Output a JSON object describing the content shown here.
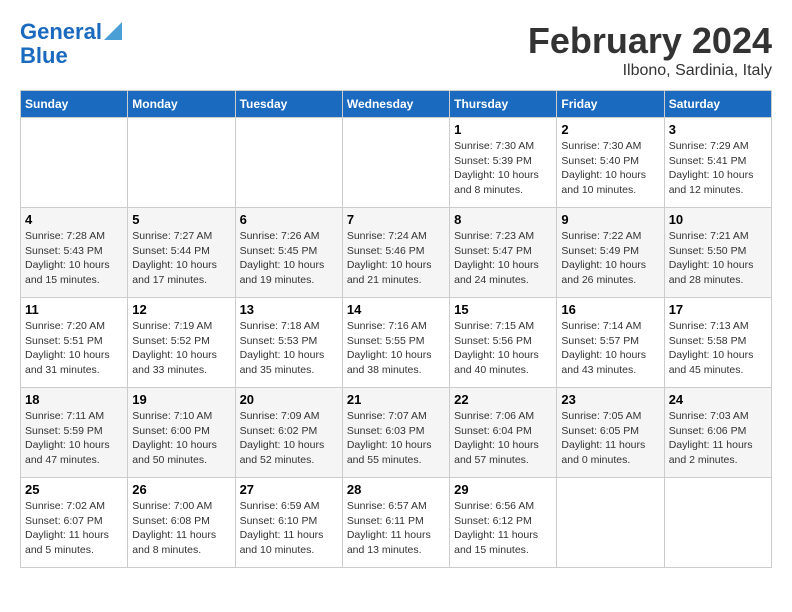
{
  "header": {
    "logo_line1": "General",
    "logo_line2": "Blue",
    "month": "February 2024",
    "location": "Ilbono, Sardinia, Italy"
  },
  "days_of_week": [
    "Sunday",
    "Monday",
    "Tuesday",
    "Wednesday",
    "Thursday",
    "Friday",
    "Saturday"
  ],
  "weeks": [
    [
      {
        "num": "",
        "info": ""
      },
      {
        "num": "",
        "info": ""
      },
      {
        "num": "",
        "info": ""
      },
      {
        "num": "",
        "info": ""
      },
      {
        "num": "1",
        "info": "Sunrise: 7:30 AM\nSunset: 5:39 PM\nDaylight: 10 hours\nand 8 minutes."
      },
      {
        "num": "2",
        "info": "Sunrise: 7:30 AM\nSunset: 5:40 PM\nDaylight: 10 hours\nand 10 minutes."
      },
      {
        "num": "3",
        "info": "Sunrise: 7:29 AM\nSunset: 5:41 PM\nDaylight: 10 hours\nand 12 minutes."
      }
    ],
    [
      {
        "num": "4",
        "info": "Sunrise: 7:28 AM\nSunset: 5:43 PM\nDaylight: 10 hours\nand 15 minutes."
      },
      {
        "num": "5",
        "info": "Sunrise: 7:27 AM\nSunset: 5:44 PM\nDaylight: 10 hours\nand 17 minutes."
      },
      {
        "num": "6",
        "info": "Sunrise: 7:26 AM\nSunset: 5:45 PM\nDaylight: 10 hours\nand 19 minutes."
      },
      {
        "num": "7",
        "info": "Sunrise: 7:24 AM\nSunset: 5:46 PM\nDaylight: 10 hours\nand 21 minutes."
      },
      {
        "num": "8",
        "info": "Sunrise: 7:23 AM\nSunset: 5:47 PM\nDaylight: 10 hours\nand 24 minutes."
      },
      {
        "num": "9",
        "info": "Sunrise: 7:22 AM\nSunset: 5:49 PM\nDaylight: 10 hours\nand 26 minutes."
      },
      {
        "num": "10",
        "info": "Sunrise: 7:21 AM\nSunset: 5:50 PM\nDaylight: 10 hours\nand 28 minutes."
      }
    ],
    [
      {
        "num": "11",
        "info": "Sunrise: 7:20 AM\nSunset: 5:51 PM\nDaylight: 10 hours\nand 31 minutes."
      },
      {
        "num": "12",
        "info": "Sunrise: 7:19 AM\nSunset: 5:52 PM\nDaylight: 10 hours\nand 33 minutes."
      },
      {
        "num": "13",
        "info": "Sunrise: 7:18 AM\nSunset: 5:53 PM\nDaylight: 10 hours\nand 35 minutes."
      },
      {
        "num": "14",
        "info": "Sunrise: 7:16 AM\nSunset: 5:55 PM\nDaylight: 10 hours\nand 38 minutes."
      },
      {
        "num": "15",
        "info": "Sunrise: 7:15 AM\nSunset: 5:56 PM\nDaylight: 10 hours\nand 40 minutes."
      },
      {
        "num": "16",
        "info": "Sunrise: 7:14 AM\nSunset: 5:57 PM\nDaylight: 10 hours\nand 43 minutes."
      },
      {
        "num": "17",
        "info": "Sunrise: 7:13 AM\nSunset: 5:58 PM\nDaylight: 10 hours\nand 45 minutes."
      }
    ],
    [
      {
        "num": "18",
        "info": "Sunrise: 7:11 AM\nSunset: 5:59 PM\nDaylight: 10 hours\nand 47 minutes."
      },
      {
        "num": "19",
        "info": "Sunrise: 7:10 AM\nSunset: 6:00 PM\nDaylight: 10 hours\nand 50 minutes."
      },
      {
        "num": "20",
        "info": "Sunrise: 7:09 AM\nSunset: 6:02 PM\nDaylight: 10 hours\nand 52 minutes."
      },
      {
        "num": "21",
        "info": "Sunrise: 7:07 AM\nSunset: 6:03 PM\nDaylight: 10 hours\nand 55 minutes."
      },
      {
        "num": "22",
        "info": "Sunrise: 7:06 AM\nSunset: 6:04 PM\nDaylight: 10 hours\nand 57 minutes."
      },
      {
        "num": "23",
        "info": "Sunrise: 7:05 AM\nSunset: 6:05 PM\nDaylight: 11 hours\nand 0 minutes."
      },
      {
        "num": "24",
        "info": "Sunrise: 7:03 AM\nSunset: 6:06 PM\nDaylight: 11 hours\nand 2 minutes."
      }
    ],
    [
      {
        "num": "25",
        "info": "Sunrise: 7:02 AM\nSunset: 6:07 PM\nDaylight: 11 hours\nand 5 minutes."
      },
      {
        "num": "26",
        "info": "Sunrise: 7:00 AM\nSunset: 6:08 PM\nDaylight: 11 hours\nand 8 minutes."
      },
      {
        "num": "27",
        "info": "Sunrise: 6:59 AM\nSunset: 6:10 PM\nDaylight: 11 hours\nand 10 minutes."
      },
      {
        "num": "28",
        "info": "Sunrise: 6:57 AM\nSunset: 6:11 PM\nDaylight: 11 hours\nand 13 minutes."
      },
      {
        "num": "29",
        "info": "Sunrise: 6:56 AM\nSunset: 6:12 PM\nDaylight: 11 hours\nand 15 minutes."
      },
      {
        "num": "",
        "info": ""
      },
      {
        "num": "",
        "info": ""
      }
    ]
  ]
}
